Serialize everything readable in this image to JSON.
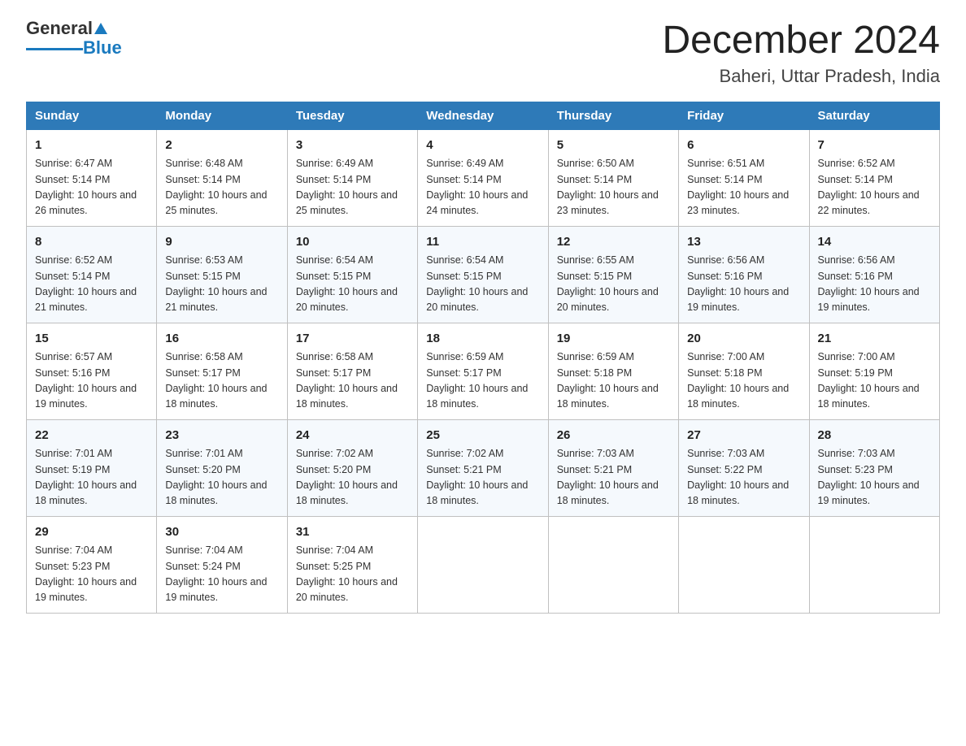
{
  "logo": {
    "general": "General",
    "blue": "Blue"
  },
  "title": "December 2024",
  "subtitle": "Baheri, Uttar Pradesh, India",
  "days_header": [
    "Sunday",
    "Monday",
    "Tuesday",
    "Wednesday",
    "Thursday",
    "Friday",
    "Saturday"
  ],
  "weeks": [
    [
      {
        "num": "1",
        "sunrise": "6:47 AM",
        "sunset": "5:14 PM",
        "daylight": "10 hours and 26 minutes."
      },
      {
        "num": "2",
        "sunrise": "6:48 AM",
        "sunset": "5:14 PM",
        "daylight": "10 hours and 25 minutes."
      },
      {
        "num": "3",
        "sunrise": "6:49 AM",
        "sunset": "5:14 PM",
        "daylight": "10 hours and 25 minutes."
      },
      {
        "num": "4",
        "sunrise": "6:49 AM",
        "sunset": "5:14 PM",
        "daylight": "10 hours and 24 minutes."
      },
      {
        "num": "5",
        "sunrise": "6:50 AM",
        "sunset": "5:14 PM",
        "daylight": "10 hours and 23 minutes."
      },
      {
        "num": "6",
        "sunrise": "6:51 AM",
        "sunset": "5:14 PM",
        "daylight": "10 hours and 23 minutes."
      },
      {
        "num": "7",
        "sunrise": "6:52 AM",
        "sunset": "5:14 PM",
        "daylight": "10 hours and 22 minutes."
      }
    ],
    [
      {
        "num": "8",
        "sunrise": "6:52 AM",
        "sunset": "5:14 PM",
        "daylight": "10 hours and 21 minutes."
      },
      {
        "num": "9",
        "sunrise": "6:53 AM",
        "sunset": "5:15 PM",
        "daylight": "10 hours and 21 minutes."
      },
      {
        "num": "10",
        "sunrise": "6:54 AM",
        "sunset": "5:15 PM",
        "daylight": "10 hours and 20 minutes."
      },
      {
        "num": "11",
        "sunrise": "6:54 AM",
        "sunset": "5:15 PM",
        "daylight": "10 hours and 20 minutes."
      },
      {
        "num": "12",
        "sunrise": "6:55 AM",
        "sunset": "5:15 PM",
        "daylight": "10 hours and 20 minutes."
      },
      {
        "num": "13",
        "sunrise": "6:56 AM",
        "sunset": "5:16 PM",
        "daylight": "10 hours and 19 minutes."
      },
      {
        "num": "14",
        "sunrise": "6:56 AM",
        "sunset": "5:16 PM",
        "daylight": "10 hours and 19 minutes."
      }
    ],
    [
      {
        "num": "15",
        "sunrise": "6:57 AM",
        "sunset": "5:16 PM",
        "daylight": "10 hours and 19 minutes."
      },
      {
        "num": "16",
        "sunrise": "6:58 AM",
        "sunset": "5:17 PM",
        "daylight": "10 hours and 18 minutes."
      },
      {
        "num": "17",
        "sunrise": "6:58 AM",
        "sunset": "5:17 PM",
        "daylight": "10 hours and 18 minutes."
      },
      {
        "num": "18",
        "sunrise": "6:59 AM",
        "sunset": "5:17 PM",
        "daylight": "10 hours and 18 minutes."
      },
      {
        "num": "19",
        "sunrise": "6:59 AM",
        "sunset": "5:18 PM",
        "daylight": "10 hours and 18 minutes."
      },
      {
        "num": "20",
        "sunrise": "7:00 AM",
        "sunset": "5:18 PM",
        "daylight": "10 hours and 18 minutes."
      },
      {
        "num": "21",
        "sunrise": "7:00 AM",
        "sunset": "5:19 PM",
        "daylight": "10 hours and 18 minutes."
      }
    ],
    [
      {
        "num": "22",
        "sunrise": "7:01 AM",
        "sunset": "5:19 PM",
        "daylight": "10 hours and 18 minutes."
      },
      {
        "num": "23",
        "sunrise": "7:01 AM",
        "sunset": "5:20 PM",
        "daylight": "10 hours and 18 minutes."
      },
      {
        "num": "24",
        "sunrise": "7:02 AM",
        "sunset": "5:20 PM",
        "daylight": "10 hours and 18 minutes."
      },
      {
        "num": "25",
        "sunrise": "7:02 AM",
        "sunset": "5:21 PM",
        "daylight": "10 hours and 18 minutes."
      },
      {
        "num": "26",
        "sunrise": "7:03 AM",
        "sunset": "5:21 PM",
        "daylight": "10 hours and 18 minutes."
      },
      {
        "num": "27",
        "sunrise": "7:03 AM",
        "sunset": "5:22 PM",
        "daylight": "10 hours and 18 minutes."
      },
      {
        "num": "28",
        "sunrise": "7:03 AM",
        "sunset": "5:23 PM",
        "daylight": "10 hours and 19 minutes."
      }
    ],
    [
      {
        "num": "29",
        "sunrise": "7:04 AM",
        "sunset": "5:23 PM",
        "daylight": "10 hours and 19 minutes."
      },
      {
        "num": "30",
        "sunrise": "7:04 AM",
        "sunset": "5:24 PM",
        "daylight": "10 hours and 19 minutes."
      },
      {
        "num": "31",
        "sunrise": "7:04 AM",
        "sunset": "5:25 PM",
        "daylight": "10 hours and 20 minutes."
      },
      null,
      null,
      null,
      null
    ]
  ]
}
